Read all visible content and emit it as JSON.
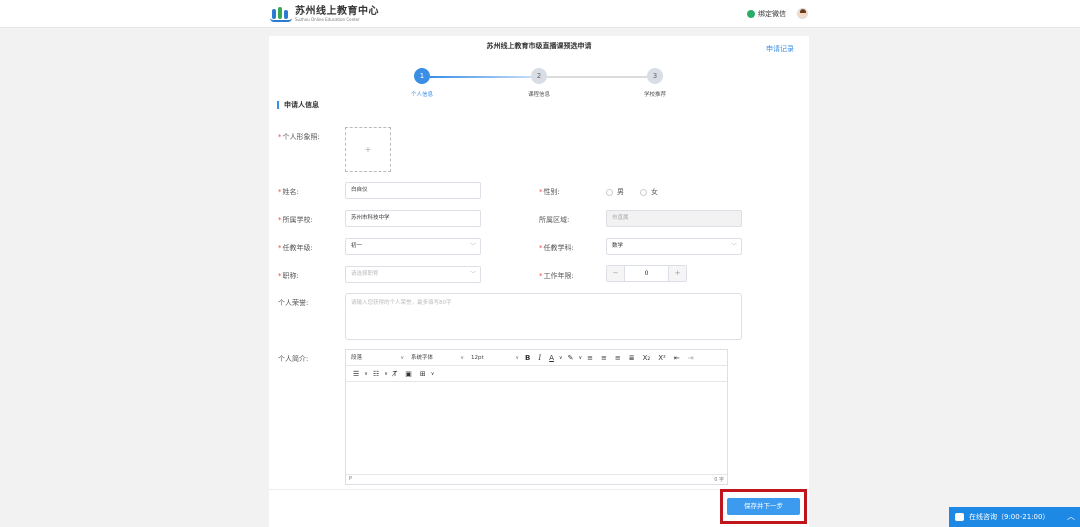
{
  "header": {
    "logo_cn": "苏州线上教育中心",
    "logo_en": "Suzhou Online Education Center",
    "wechat_label": "绑定微信"
  },
  "page": {
    "title": "苏州线上教育市级直播课预选申请",
    "record_link": "申请记录"
  },
  "steps": [
    {
      "num": "1",
      "label": "个人信息",
      "active": true
    },
    {
      "num": "2",
      "label": "课程信息",
      "active": false
    },
    {
      "num": "3",
      "label": "学校推荐",
      "active": false
    }
  ],
  "section_title": "申请人信息",
  "form": {
    "photo_label": "个人形象照:",
    "upload_plus": "+",
    "name_label": "姓名:",
    "name_value": "白自仪",
    "gender_label": "性别:",
    "gender_male": "男",
    "gender_female": "女",
    "school_label": "所属学校:",
    "school_value": "苏州市科技中学",
    "area_label": "所属区域:",
    "area_value": "市直属",
    "grade_label": "任教年级:",
    "grade_value": "初一",
    "subject_label": "任教学科:",
    "subject_value": "数学",
    "title_label": "职称:",
    "title_placeholder": "请选择职称",
    "years_label": "工作年限:",
    "years_value": "0",
    "years_minus": "−",
    "years_plus": "+",
    "honor_label": "个人荣誉:",
    "honor_placeholder": "请输入您获得的个人荣誉，最多填写80字",
    "intro_label": "个人简介:"
  },
  "editor": {
    "format": "段落",
    "font": "系统字体",
    "size": "12pt",
    "status_path": "P",
    "word_count": "0 字"
  },
  "save_button": "保存并下一步",
  "consult": "在线咨询（9:00-21:00）",
  "colors": {
    "accent": "#3a8ee6",
    "highlight_frame": "#c0151c",
    "consult_bg": "#1e88e5"
  }
}
